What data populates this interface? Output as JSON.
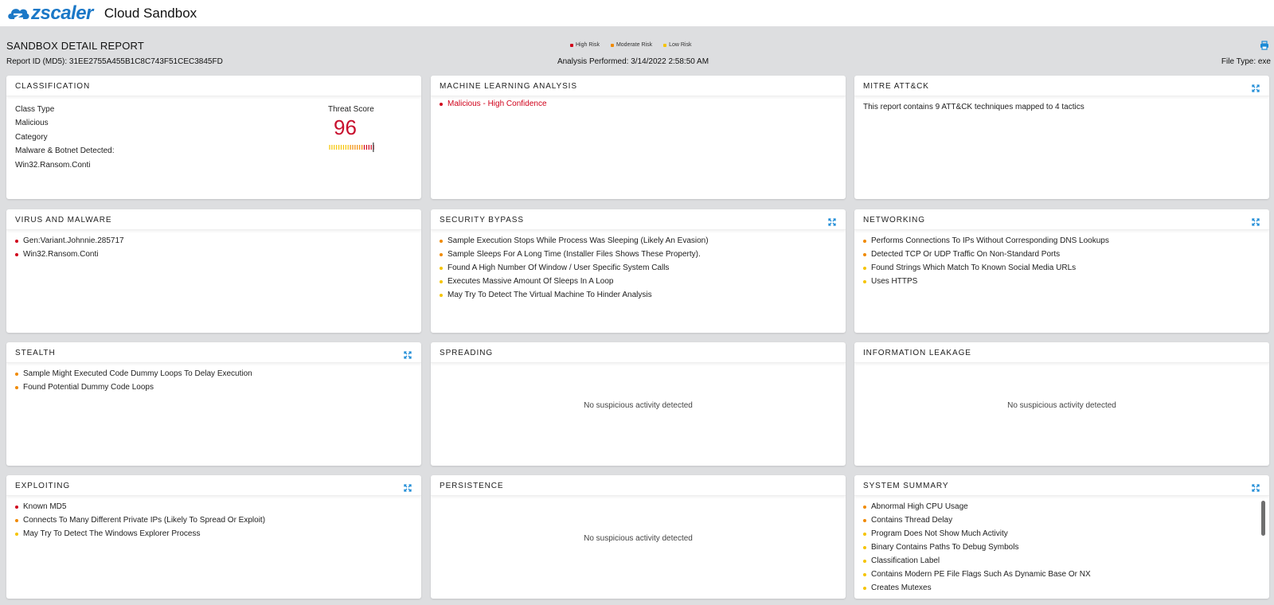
{
  "app": {
    "logo_text": "zscaler",
    "title": "Cloud Sandbox"
  },
  "report": {
    "title": "SANDBOX DETAIL REPORT",
    "report_id": "Report ID (MD5): 31EE2755A455B1C8C743F51CEC3845FD",
    "analysis": "Analysis Performed: 3/14/2022 2:58:50 AM",
    "file_type": "File Type: exe"
  },
  "legend": [
    {
      "label": "High Risk",
      "color": "#d0021b"
    },
    {
      "label": "Moderate Risk",
      "color": "#f08a00"
    },
    {
      "label": "Low Risk",
      "color": "#f5c400"
    }
  ],
  "colors": {
    "high": "#d0021b",
    "moderate": "#f08a00",
    "low": "#f5c400",
    "accent": "#1b8ad6"
  },
  "empty_text": "No suspicious activity detected",
  "classification": {
    "title": "CLASSIFICATION",
    "class_type_label": "Class Type",
    "class_type_value": "Malicious",
    "category_label": "Category",
    "category_value": "Malware & Botnet Detected:",
    "detection": "Win32.Ransom.Conti",
    "threat_score_label": "Threat Score",
    "threat_score": "96"
  },
  "ml": {
    "title": "MACHINE LEARNING ANALYSIS",
    "items": [
      {
        "text": "Malicious - High Confidence",
        "risk": "high"
      }
    ]
  },
  "mitre": {
    "title": "MITRE ATT&CK",
    "text": "This report contains 9 ATT&CK techniques mapped to 4 tactics"
  },
  "virus": {
    "title": "VIRUS AND MALWARE",
    "items": [
      {
        "text": "Gen:Variant.Johnnie.285717",
        "risk": "high"
      },
      {
        "text": "Win32.Ransom.Conti",
        "risk": "high"
      }
    ]
  },
  "security_bypass": {
    "title": "SECURITY BYPASS",
    "items": [
      {
        "text": "Sample Execution Stops While Process Was Sleeping (Likely An Evasion)",
        "risk": "moderate"
      },
      {
        "text": "Sample Sleeps For A Long Time (Installer Files Shows These Property).",
        "risk": "moderate"
      },
      {
        "text": "Found A High Number Of Window / User Specific System Calls",
        "risk": "low"
      },
      {
        "text": "Executes Massive Amount Of Sleeps In A Loop",
        "risk": "low"
      },
      {
        "text": "May Try To Detect The Virtual Machine To Hinder Analysis",
        "risk": "low"
      }
    ]
  },
  "networking": {
    "title": "NETWORKING",
    "items": [
      {
        "text": "Performs Connections To IPs Without Corresponding DNS Lookups",
        "risk": "moderate"
      },
      {
        "text": "Detected TCP Or UDP Traffic On Non-Standard Ports",
        "risk": "moderate"
      },
      {
        "text": "Found Strings Which Match To Known Social Media URLs",
        "risk": "low"
      },
      {
        "text": "Uses HTTPS",
        "risk": "low"
      }
    ]
  },
  "stealth": {
    "title": "STEALTH",
    "items": [
      {
        "text": "Sample Might Executed Code Dummy Loops To Delay Execution",
        "risk": "moderate"
      },
      {
        "text": "Found Potential Dummy Code Loops",
        "risk": "moderate"
      }
    ]
  },
  "spreading": {
    "title": "SPREADING"
  },
  "info_leakage": {
    "title": "INFORMATION LEAKAGE"
  },
  "exploiting": {
    "title": "EXPLOITING",
    "items": [
      {
        "text": "Known MD5",
        "risk": "high"
      },
      {
        "text": "Connects To Many Different Private IPs (Likely To Spread Or Exploit)",
        "risk": "moderate"
      },
      {
        "text": "May Try To Detect The Windows Explorer Process",
        "risk": "low"
      }
    ]
  },
  "persistence": {
    "title": "PERSISTENCE"
  },
  "system_summary": {
    "title": "SYSTEM SUMMARY",
    "items": [
      {
        "text": "Abnormal High CPU Usage",
        "risk": "moderate"
      },
      {
        "text": "Contains Thread Delay",
        "risk": "moderate"
      },
      {
        "text": "Program Does Not Show Much Activity",
        "risk": "low"
      },
      {
        "text": "Binary Contains Paths To Debug Symbols",
        "risk": "low"
      },
      {
        "text": "Classification Label",
        "risk": "low"
      },
      {
        "text": "Contains Modern PE File Flags Such As Dynamic Base Or NX",
        "risk": "low"
      },
      {
        "text": "Creates Mutexes",
        "risk": "low"
      }
    ]
  }
}
